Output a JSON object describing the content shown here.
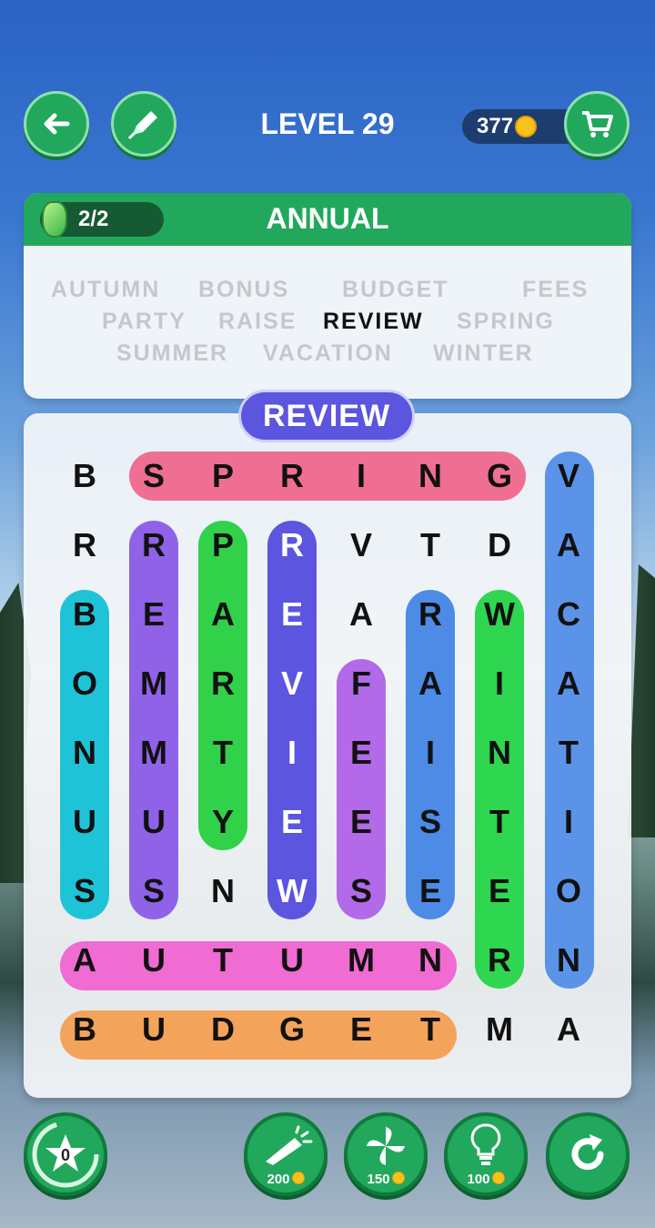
{
  "header": {
    "level": "LEVEL 29",
    "coins": "377"
  },
  "panel": {
    "progress": "2/2",
    "title": "ANNUAL",
    "words": [
      {
        "text": "AUTUMN",
        "found": false
      },
      {
        "text": "BONUS",
        "found": false
      },
      {
        "text": "BUDGET",
        "found": false
      },
      {
        "text": "FEES",
        "found": false
      },
      {
        "text": "PARTY",
        "found": false
      },
      {
        "text": "RAISE",
        "found": false
      },
      {
        "text": "REVIEW",
        "found": true
      },
      {
        "text": "SPRING",
        "found": false
      },
      {
        "text": "SUMMER",
        "found": false
      },
      {
        "text": "VACATION",
        "found": false
      },
      {
        "text": "WINTER",
        "found": false
      }
    ]
  },
  "current_word": "REVIEW",
  "grid": [
    [
      "B",
      "S",
      "P",
      "R",
      "I",
      "N",
      "G",
      "V"
    ],
    [
      "R",
      "R",
      "P",
      "R",
      "V",
      "T",
      "D",
      "A"
    ],
    [
      "B",
      "E",
      "A",
      "E",
      "A",
      "R",
      "W",
      "C"
    ],
    [
      "O",
      "M",
      "R",
      "V",
      "F",
      "A",
      "I",
      "A"
    ],
    [
      "N",
      "M",
      "T",
      "I",
      "E",
      "I",
      "N",
      "T"
    ],
    [
      "U",
      "U",
      "Y",
      "E",
      "E",
      "S",
      "T",
      "I"
    ],
    [
      "S",
      "S",
      "N",
      "W",
      "S",
      "E",
      "E",
      "O"
    ],
    [
      "A",
      "U",
      "T",
      "U",
      "M",
      "N",
      "R",
      "N"
    ],
    [
      "B",
      "U",
      "D",
      "G",
      "E",
      "T",
      "M",
      "A"
    ]
  ],
  "found_highlights": [
    {
      "word": "SPRING",
      "color": "#ef6f92"
    },
    {
      "word": "VACATION",
      "color": "#5b93e8"
    },
    {
      "word": "SUMMER",
      "color": "#8f62e8"
    },
    {
      "word": "PARTY",
      "color": "#31d14a"
    },
    {
      "word": "REVIEW",
      "color": "#5b55e0"
    },
    {
      "word": "BONUS",
      "color": "#1fc3d8"
    },
    {
      "word": "FEES",
      "color": "#b26ae8"
    },
    {
      "word": "RAISE",
      "color": "#4d8be6"
    },
    {
      "word": "WINTER",
      "color": "#2fd650"
    },
    {
      "word": "AUTUMN",
      "color": "#f06bd2"
    },
    {
      "word": "BUDGET",
      "color": "#f4a35a"
    }
  ],
  "bottom_bar": {
    "stars": "0",
    "boosters": [
      {
        "name": "firework",
        "price": "200"
      },
      {
        "name": "pinwheel",
        "price": "150"
      },
      {
        "name": "lightbulb",
        "price": "100"
      }
    ]
  }
}
